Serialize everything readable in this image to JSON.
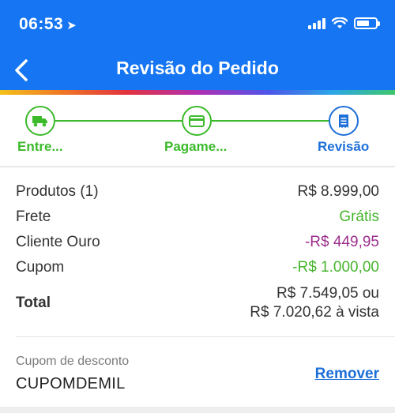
{
  "status_bar": {
    "time": "06:53",
    "location_glyph": "➤"
  },
  "header": {
    "title": "Revisão do Pedido"
  },
  "steps": [
    {
      "label": "Entre...",
      "icon": "truck-icon"
    },
    {
      "label": "Pagame...",
      "icon": "credit-card-icon"
    },
    {
      "label": "Revisão",
      "icon": "receipt-icon"
    }
  ],
  "summary": {
    "products": {
      "label": "Produtos (1)",
      "value": "R$ 8.999,00"
    },
    "shipping": {
      "label": "Frete",
      "value": "Grátis"
    },
    "gold_client": {
      "label": "Cliente Ouro",
      "value": "-R$ 449,95"
    },
    "coupon": {
      "label": "Cupom",
      "value": "-R$ 1.000,00"
    },
    "total": {
      "label": "Total",
      "value_line1": "R$ 7.549,05 ou",
      "value_line2": "R$ 7.020,62 à vista"
    }
  },
  "coupon_section": {
    "label": "Cupom de desconto",
    "code": "CUPOMDEMIL",
    "remove_label": "Remover"
  },
  "colors": {
    "primary": "#1575f2",
    "success": "#46b52d",
    "gold": "#9b2e8c",
    "link": "#1d6fd8"
  }
}
